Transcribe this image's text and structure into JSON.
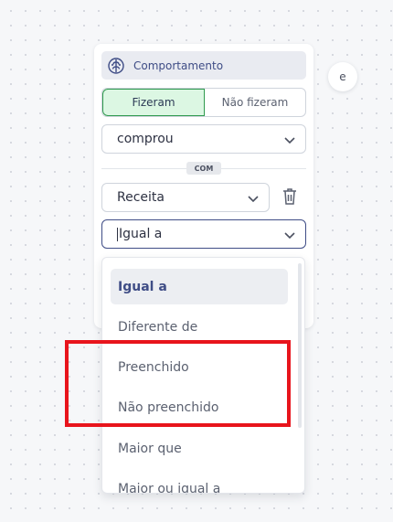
{
  "card": {
    "header_label": "Comportamento",
    "toggle": {
      "active": "Fizeram",
      "inactive": "Não fizeram"
    },
    "event_select": "comprou",
    "badge": "COM",
    "property_select": "Receita",
    "operator_select": "Igual a"
  },
  "side_chip": "e",
  "dropdown": {
    "items": [
      "Igual a",
      "Diferente de",
      "Preenchido",
      "Não preenchido",
      "Maior que",
      "Maior ou igual a"
    ],
    "selected": "Igual a"
  },
  "icons": [
    "brain-icon",
    "chevron-down-icon",
    "trash-icon"
  ],
  "colors": {
    "accent": "#3f4d86",
    "active_toggle_bg": "#dcf7e3",
    "active_toggle_border": "#2f9a4e",
    "highlight": "#e8141c"
  }
}
